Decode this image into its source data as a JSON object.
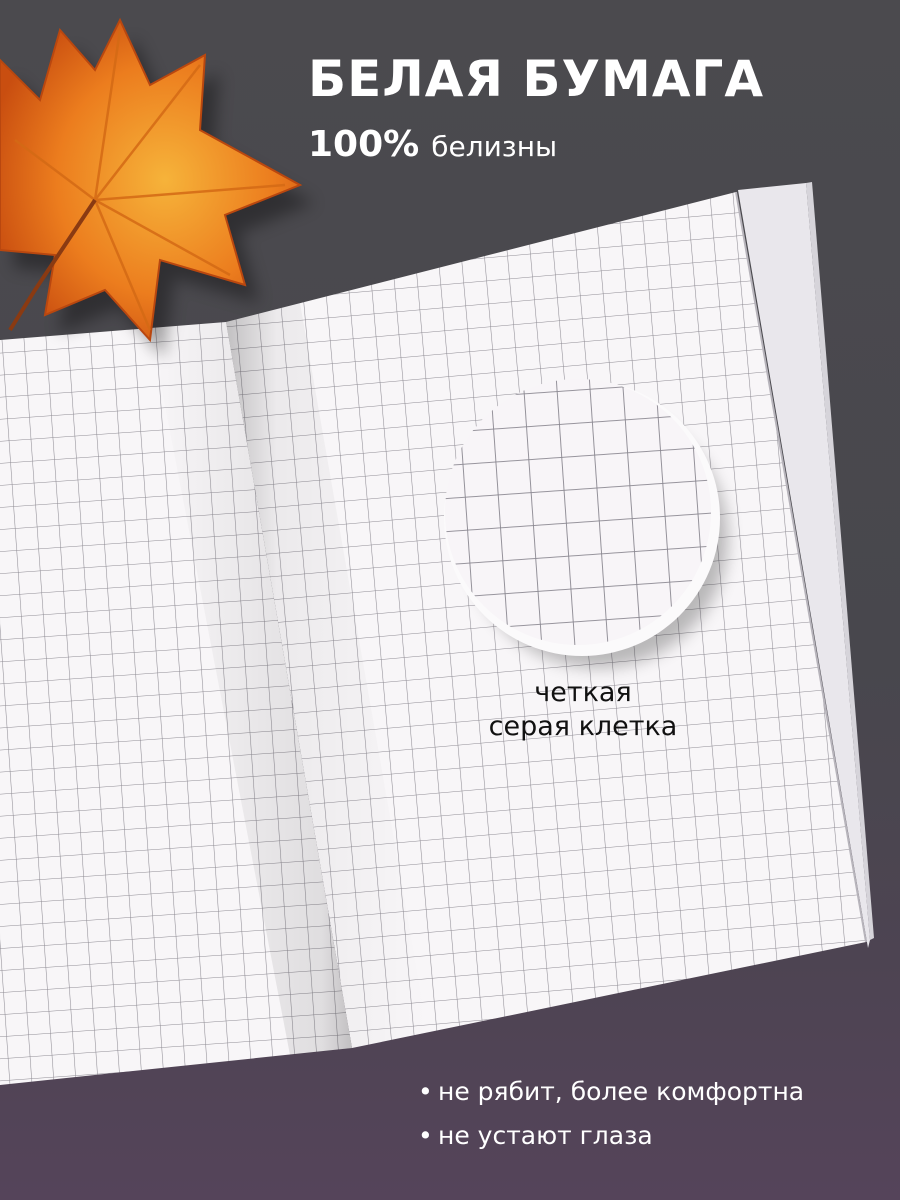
{
  "header": {
    "title": "БЕЛАЯ БУМАГА",
    "percent": "100%",
    "percent_word": "белизны"
  },
  "loupe": {
    "caption_line1": "четкая",
    "caption_line2": "серая клетка"
  },
  "benefits": {
    "items": [
      {
        "bullet": "•",
        "text": "не рябит, более комфортна"
      },
      {
        "bullet": "•",
        "text": "не устают глаза"
      }
    ]
  },
  "colors": {
    "background": "#4b4a4e",
    "paper": "#f8f6f8",
    "grid_line": "#8f8c94",
    "leaf_orange": "#e8701a",
    "leaf_yellow": "#f2a431",
    "text_light": "#ffffff",
    "text_dark": "#111111"
  }
}
